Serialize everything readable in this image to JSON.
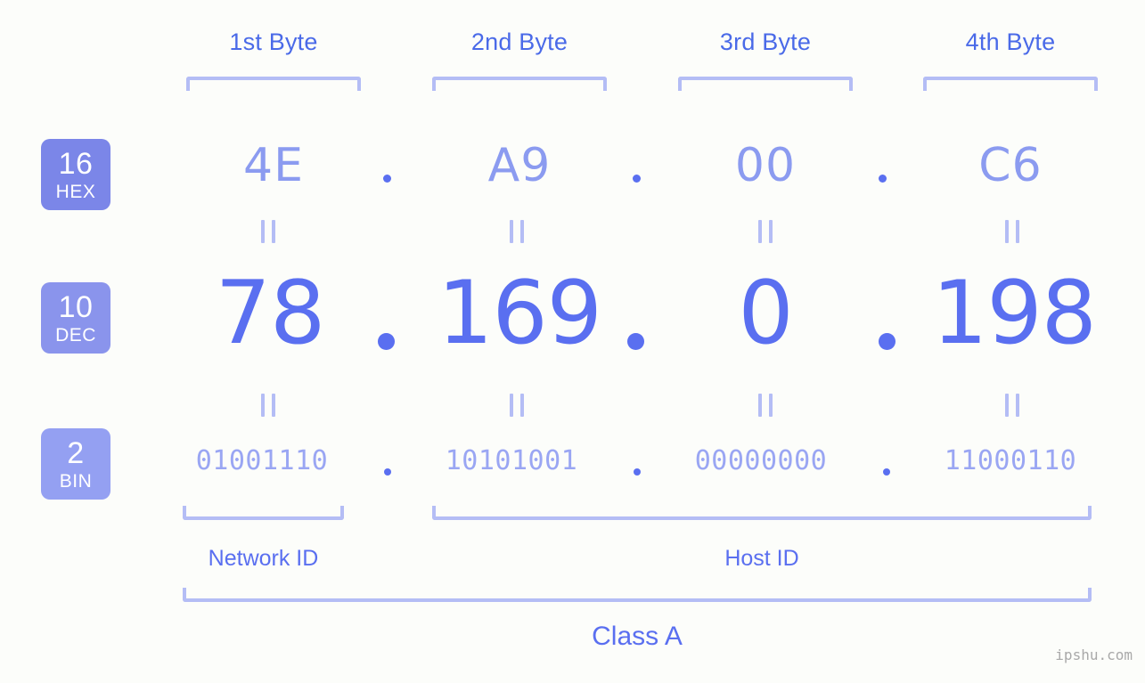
{
  "theme": {
    "background": "#fcfdfa",
    "label_blue": "#4a6ae8",
    "bracket_blue": "#b4bdf5",
    "hex_value_blue": "#8b9bf0",
    "dec_value_blue": "#5a6ff0",
    "bin_value_blue": "#9aa6f3",
    "badge_hex_bg": "#7b86e8",
    "badge_dec_bg": "#8a94ec",
    "badge_bin_bg": "#94a0f2",
    "watermark_gray": "#a9a9a9"
  },
  "byte_headers": [
    {
      "label": "1st Byte"
    },
    {
      "label": "2nd Byte"
    },
    {
      "label": "3rd Byte"
    },
    {
      "label": "4th Byte"
    }
  ],
  "bases": [
    {
      "number": "16",
      "name": "HEX"
    },
    {
      "number": "10",
      "name": "DEC"
    },
    {
      "number": "2",
      "name": "BIN"
    }
  ],
  "rows": {
    "hex": {
      "base": "16",
      "base_name": "HEX",
      "values": [
        "4E",
        "A9",
        "00",
        "C6"
      ],
      "separator": "."
    },
    "dec": {
      "base": "10",
      "base_name": "DEC",
      "values": [
        "78",
        "169",
        "0",
        "198"
      ],
      "separator": "."
    },
    "bin": {
      "base": "2",
      "base_name": "BIN",
      "values": [
        "01001110",
        "10101001",
        "00000000",
        "11000110"
      ],
      "separator": "."
    }
  },
  "equality_symbol": "=",
  "segments": {
    "network_id": {
      "label": "Network ID"
    },
    "host_id": {
      "label": "Host ID"
    },
    "class": {
      "label": "Class A"
    }
  },
  "watermark": {
    "text": "ipshu.com"
  }
}
